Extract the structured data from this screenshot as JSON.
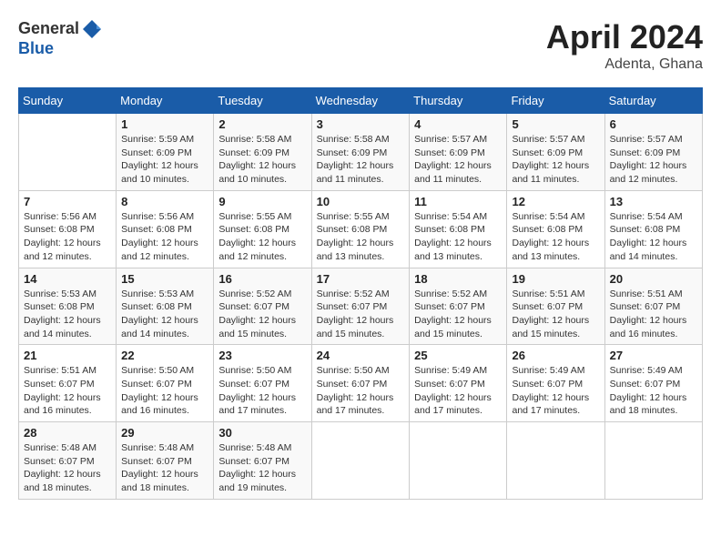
{
  "header": {
    "logo_general": "General",
    "logo_blue": "Blue",
    "month_title": "April 2024",
    "location": "Adenta, Ghana"
  },
  "calendar": {
    "weekdays": [
      "Sunday",
      "Monday",
      "Tuesday",
      "Wednesday",
      "Thursday",
      "Friday",
      "Saturday"
    ],
    "weeks": [
      [
        {
          "day": "",
          "info": ""
        },
        {
          "day": "1",
          "info": "Sunrise: 5:59 AM\nSunset: 6:09 PM\nDaylight: 12 hours\nand 10 minutes."
        },
        {
          "day": "2",
          "info": "Sunrise: 5:58 AM\nSunset: 6:09 PM\nDaylight: 12 hours\nand 10 minutes."
        },
        {
          "day": "3",
          "info": "Sunrise: 5:58 AM\nSunset: 6:09 PM\nDaylight: 12 hours\nand 11 minutes."
        },
        {
          "day": "4",
          "info": "Sunrise: 5:57 AM\nSunset: 6:09 PM\nDaylight: 12 hours\nand 11 minutes."
        },
        {
          "day": "5",
          "info": "Sunrise: 5:57 AM\nSunset: 6:09 PM\nDaylight: 12 hours\nand 11 minutes."
        },
        {
          "day": "6",
          "info": "Sunrise: 5:57 AM\nSunset: 6:09 PM\nDaylight: 12 hours\nand 12 minutes."
        }
      ],
      [
        {
          "day": "7",
          "info": "Sunrise: 5:56 AM\nSunset: 6:08 PM\nDaylight: 12 hours\nand 12 minutes."
        },
        {
          "day": "8",
          "info": "Sunrise: 5:56 AM\nSunset: 6:08 PM\nDaylight: 12 hours\nand 12 minutes."
        },
        {
          "day": "9",
          "info": "Sunrise: 5:55 AM\nSunset: 6:08 PM\nDaylight: 12 hours\nand 12 minutes."
        },
        {
          "day": "10",
          "info": "Sunrise: 5:55 AM\nSunset: 6:08 PM\nDaylight: 12 hours\nand 13 minutes."
        },
        {
          "day": "11",
          "info": "Sunrise: 5:54 AM\nSunset: 6:08 PM\nDaylight: 12 hours\nand 13 minutes."
        },
        {
          "day": "12",
          "info": "Sunrise: 5:54 AM\nSunset: 6:08 PM\nDaylight: 12 hours\nand 13 minutes."
        },
        {
          "day": "13",
          "info": "Sunrise: 5:54 AM\nSunset: 6:08 PM\nDaylight: 12 hours\nand 14 minutes."
        }
      ],
      [
        {
          "day": "14",
          "info": "Sunrise: 5:53 AM\nSunset: 6:08 PM\nDaylight: 12 hours\nand 14 minutes."
        },
        {
          "day": "15",
          "info": "Sunrise: 5:53 AM\nSunset: 6:08 PM\nDaylight: 12 hours\nand 14 minutes."
        },
        {
          "day": "16",
          "info": "Sunrise: 5:52 AM\nSunset: 6:07 PM\nDaylight: 12 hours\nand 15 minutes."
        },
        {
          "day": "17",
          "info": "Sunrise: 5:52 AM\nSunset: 6:07 PM\nDaylight: 12 hours\nand 15 minutes."
        },
        {
          "day": "18",
          "info": "Sunrise: 5:52 AM\nSunset: 6:07 PM\nDaylight: 12 hours\nand 15 minutes."
        },
        {
          "day": "19",
          "info": "Sunrise: 5:51 AM\nSunset: 6:07 PM\nDaylight: 12 hours\nand 15 minutes."
        },
        {
          "day": "20",
          "info": "Sunrise: 5:51 AM\nSunset: 6:07 PM\nDaylight: 12 hours\nand 16 minutes."
        }
      ],
      [
        {
          "day": "21",
          "info": "Sunrise: 5:51 AM\nSunset: 6:07 PM\nDaylight: 12 hours\nand 16 minutes."
        },
        {
          "day": "22",
          "info": "Sunrise: 5:50 AM\nSunset: 6:07 PM\nDaylight: 12 hours\nand 16 minutes."
        },
        {
          "day": "23",
          "info": "Sunrise: 5:50 AM\nSunset: 6:07 PM\nDaylight: 12 hours\nand 17 minutes."
        },
        {
          "day": "24",
          "info": "Sunrise: 5:50 AM\nSunset: 6:07 PM\nDaylight: 12 hours\nand 17 minutes."
        },
        {
          "day": "25",
          "info": "Sunrise: 5:49 AM\nSunset: 6:07 PM\nDaylight: 12 hours\nand 17 minutes."
        },
        {
          "day": "26",
          "info": "Sunrise: 5:49 AM\nSunset: 6:07 PM\nDaylight: 12 hours\nand 17 minutes."
        },
        {
          "day": "27",
          "info": "Sunrise: 5:49 AM\nSunset: 6:07 PM\nDaylight: 12 hours\nand 18 minutes."
        }
      ],
      [
        {
          "day": "28",
          "info": "Sunrise: 5:48 AM\nSunset: 6:07 PM\nDaylight: 12 hours\nand 18 minutes."
        },
        {
          "day": "29",
          "info": "Sunrise: 5:48 AM\nSunset: 6:07 PM\nDaylight: 12 hours\nand 18 minutes."
        },
        {
          "day": "30",
          "info": "Sunrise: 5:48 AM\nSunset: 6:07 PM\nDaylight: 12 hours\nand 19 minutes."
        },
        {
          "day": "",
          "info": ""
        },
        {
          "day": "",
          "info": ""
        },
        {
          "day": "",
          "info": ""
        },
        {
          "day": "",
          "info": ""
        }
      ]
    ]
  }
}
